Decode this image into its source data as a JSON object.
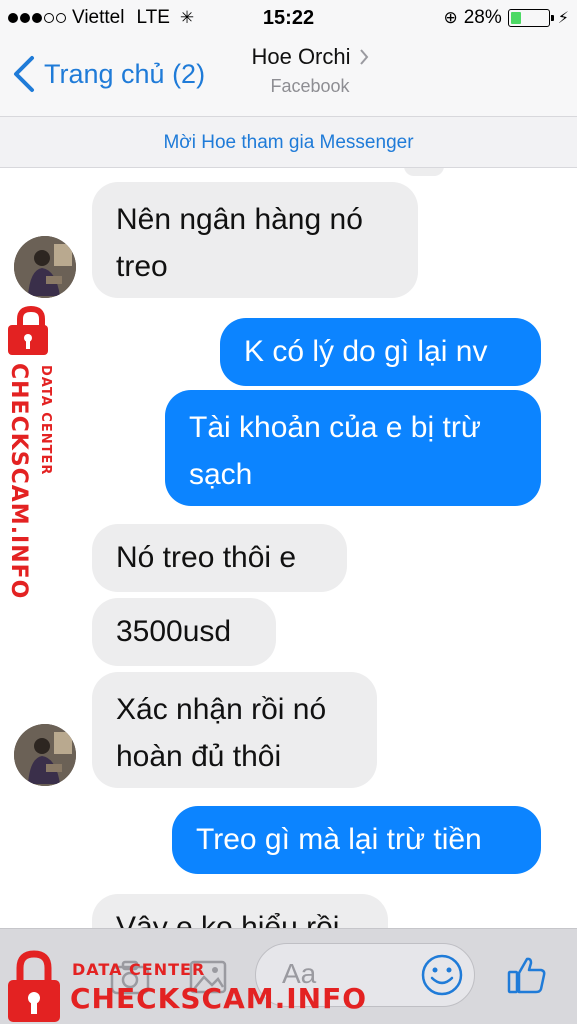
{
  "status_bar": {
    "carrier": "Viettel",
    "network": "LTE",
    "time": "15:22",
    "battery": "28%",
    "battery_level": 0.28
  },
  "nav": {
    "back_label": "Trang chủ (2)",
    "contact_name": "Hoe Orchi",
    "contact_source": "Facebook"
  },
  "banner": {
    "invite_text": "Mời Hoe tham gia Messenger"
  },
  "messages": [
    {
      "side": "in",
      "text_lines": [
        "Nên ngân hàng nó",
        "treo"
      ]
    },
    {
      "side": "out",
      "text_lines": [
        "K có lý do gì lại nv"
      ]
    },
    {
      "side": "out",
      "text_lines": [
        "Tài khoản của e bị trừ",
        "sạch"
      ]
    },
    {
      "side": "in",
      "text_lines": [
        "Nó treo thôi e"
      ]
    },
    {
      "side": "in",
      "text_lines": [
        "3500usd"
      ]
    },
    {
      "side": "in",
      "text_lines": [
        "Xác nhận rồi nó",
        "hoàn đủ thôi"
      ]
    },
    {
      "side": "out",
      "text_lines": [
        "Treo gì mà lại trừ tiền"
      ]
    },
    {
      "side": "in",
      "text_lines": [
        "Vậy e ko hiểu rồi"
      ]
    }
  ],
  "composer": {
    "placeholder": "Aa",
    "icons": [
      "camera-icon",
      "gallery-icon",
      "emoji-icon",
      "thumbs-up-icon"
    ]
  },
  "watermark": {
    "side_line1": "DATA CENTER",
    "side_line2": "CHECKSCAM.INFO",
    "bottom_line1": "DATA CENTER",
    "bottom_line2": "CHECKSCAM.INFO",
    "color": "#e32222"
  },
  "colors": {
    "accent": "#1f7bd8",
    "outgoing_bubble": "#0c84ff",
    "incoming_bubble": "#ededee"
  }
}
